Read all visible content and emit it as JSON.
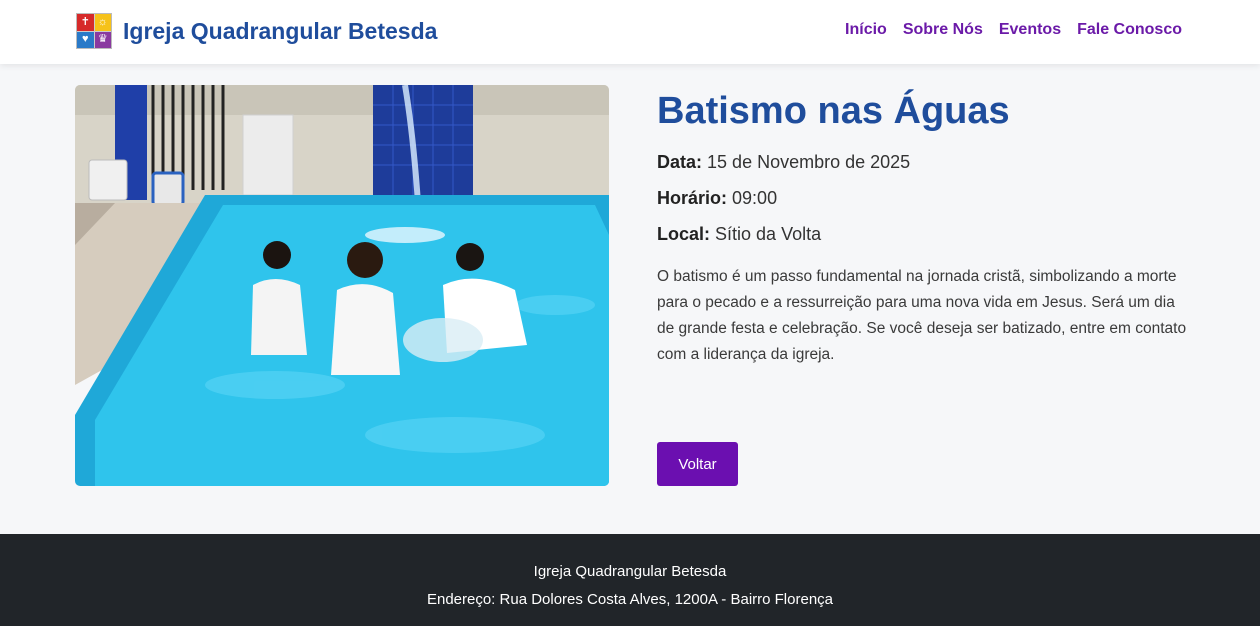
{
  "header": {
    "brand": "Igreja Quadrangular Betesda",
    "nav": [
      {
        "label": "Início"
      },
      {
        "label": "Sobre Nós"
      },
      {
        "label": "Eventos"
      },
      {
        "label": "Fale Conosco"
      }
    ]
  },
  "event": {
    "title": "Batismo nas Águas",
    "date_label": "Data:",
    "date_value": "15 de Novembro de 2025",
    "time_label": "Horário:",
    "time_value": "09:00",
    "place_label": "Local:",
    "place_value": "Sítio da Volta",
    "description": "O batismo é um passo fundamental na jornada cristã, simbolizando a morte para o pecado e a ressurreição para uma nova vida em Jesus. Será um dia de grande festa e celebração. Se você deseja ser batizado, entre em contato com a liderança da igreja.",
    "back_label": "Voltar"
  },
  "footer": {
    "line1": "Igreja Quadrangular Betesda",
    "line2": "Endereço: Rua Dolores Costa Alves, 1200A - Bairro Florença"
  },
  "colors": {
    "brand_blue": "#1f4d9c",
    "nav_purple": "#6b1aa8",
    "button_purple": "#6b0fb0",
    "footer_bg": "#212529"
  },
  "icons": {
    "logo": "church-logo-icon"
  }
}
